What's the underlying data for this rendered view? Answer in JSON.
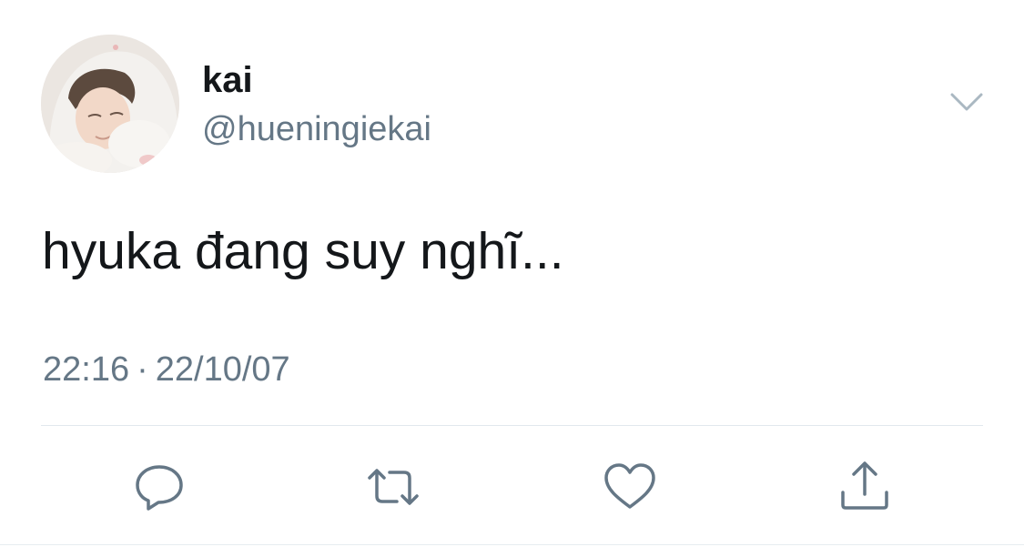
{
  "user": {
    "display_name": "kai",
    "handle": "@hueningiekai",
    "avatar_icon": "avatar-photo"
  },
  "tweet": {
    "text": "hyuka đang suy nghĩ...",
    "time": "22:16",
    "separator": "·",
    "date": "22/10/07"
  },
  "actions": [
    {
      "name": "reply",
      "icon": "speech-bubble-icon"
    },
    {
      "name": "retweet",
      "icon": "retweet-arrows-icon"
    },
    {
      "name": "like",
      "icon": "heart-icon"
    },
    {
      "name": "share",
      "icon": "share-upload-icon"
    }
  ],
  "menu": {
    "icon": "chevron-down-icon"
  },
  "colors": {
    "text_primary": "#14171a",
    "text_secondary": "#657786",
    "icon": "#657786",
    "divider": "#e1e8ed",
    "background": "#ffffff"
  }
}
